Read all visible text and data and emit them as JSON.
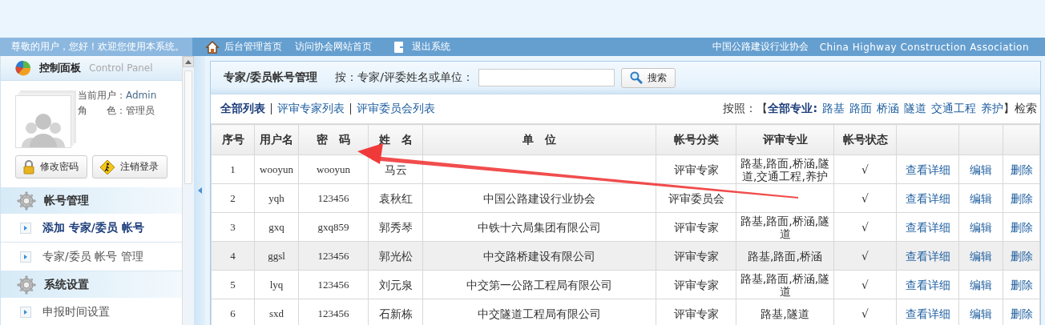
{
  "nav": {
    "welcome": "尊敬的用户，您好！欢迎您使用本系统。",
    "links": [
      {
        "label": "后台管理首页",
        "kind": "home"
      },
      {
        "label": "访问协会网站首页",
        "kind": "plain"
      },
      {
        "label": "退出系统",
        "kind": "exit"
      }
    ],
    "org": "中国公路建设行业协会",
    "org_en": "China Highway Construction Association"
  },
  "sidebar": {
    "title": "控制面板",
    "subtitle": "Control Panel",
    "user_label": "当前用户：",
    "user": "Admin",
    "role_label": "角　　色：",
    "role": "管理员",
    "buttons": [
      {
        "label": "修改密码",
        "kind": "lock"
      },
      {
        "label": "注销登录",
        "kind": "logout"
      }
    ],
    "sections": [
      {
        "title": "帐号管理",
        "items": [
          {
            "label": "添加 专家/委员 帐号",
            "selected": true
          },
          {
            "label": "专家/委员 帐号 管理",
            "selected": false
          }
        ]
      },
      {
        "title": "系统设置",
        "items": [
          {
            "label": "申报时间设置",
            "selected": false
          }
        ]
      }
    ]
  },
  "panel": {
    "title": "专家/委员帐号管理",
    "search_label": "按：专家/评委姓名或单位：",
    "search_button": "搜索",
    "lists": [
      {
        "label": "全部列表",
        "selected": true
      },
      {
        "label": "评审专家列表",
        "selected": false
      },
      {
        "label": "评审委员会列表",
        "selected": false
      }
    ],
    "filter_prefix": "按照：【",
    "specialties": [
      {
        "label": "全部专业:",
        "selected": true
      },
      {
        "label": "路基",
        "selected": false
      },
      {
        "label": "路面",
        "selected": false
      },
      {
        "label": "桥涵",
        "selected": false
      },
      {
        "label": "隧道",
        "selected": false
      },
      {
        "label": "交通工程",
        "selected": false
      },
      {
        "label": "养护",
        "selected": false
      }
    ],
    "filter_suffix": "】检索"
  },
  "table": {
    "columns": [
      "序号",
      "用户名",
      "密　码",
      "姓　名",
      "单　位",
      "帐号分类",
      "评审专业",
      "帐号状态"
    ],
    "rows": [
      {
        "no": "1",
        "username": "wooyun",
        "password": "wooyun",
        "name": "马云",
        "unit": "",
        "type": "评审专家",
        "specialty": "路基,路面,桥涵,隧道,交通工程,养护",
        "status": "√",
        "actions": [
          "查看详细",
          "编辑",
          "删除"
        ],
        "selected": false
      },
      {
        "no": "2",
        "username": "yqh",
        "password": "123456",
        "name": "袁秋红",
        "unit": "中国公路建设行业协会",
        "type": "评审委员会",
        "specialty": "",
        "status": "√",
        "actions": [
          "查看详细",
          "编辑",
          "删除"
        ],
        "selected": false
      },
      {
        "no": "3",
        "username": "gxq",
        "password": "gxq859",
        "name": "郭秀琴",
        "unit": "中铁十六局集团有限公司",
        "type": "评审专家",
        "specialty": "路基,路面,桥涵,隧道",
        "status": "√",
        "actions": [
          "查看详细",
          "编辑",
          "删除"
        ],
        "selected": false
      },
      {
        "no": "4",
        "username": "ggsl",
        "password": "123456",
        "name": "郭光松",
        "unit": "中交路桥建设有限公司",
        "type": "评审专家",
        "specialty": "路基,路面,桥涵",
        "status": "√",
        "actions": [
          "查看详细",
          "编辑",
          "删除"
        ],
        "selected": true
      },
      {
        "no": "5",
        "username": "lyq",
        "password": "123456",
        "name": "刘元泉",
        "unit": "中交第一公路工程局有限公司",
        "type": "评审专家",
        "specialty": "路基,路面,桥涵,隧道",
        "status": "√",
        "actions": [
          "查看详细",
          "编辑",
          "删除"
        ],
        "selected": false
      },
      {
        "no": "6",
        "username": "sxd",
        "password": "123456",
        "name": "石新栋",
        "unit": "中交隧道工程局有限公司",
        "type": "评审专家",
        "specialty": "路基,隧道",
        "status": "√",
        "actions": [
          "查看详细",
          "编辑",
          "删除"
        ],
        "selected": false
      }
    ]
  }
}
